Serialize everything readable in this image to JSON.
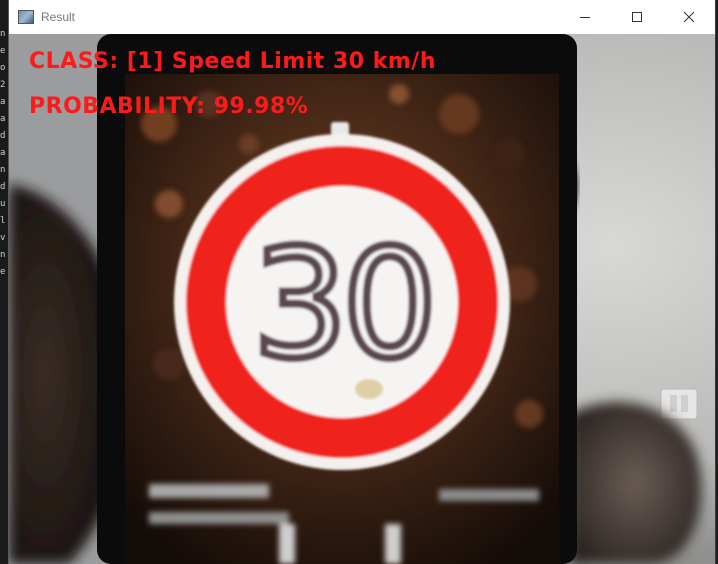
{
  "window": {
    "title": "Result",
    "icon": "opencv-window-icon",
    "controls": [
      "minimize-icon",
      "maximize-icon",
      "close-icon"
    ]
  },
  "overlay": {
    "class_text": "CLASS:  [1] Speed Limit 30 km/h",
    "probability_text": "PROBABILITY: 99.98%",
    "text_color": "#ff1a1a"
  },
  "sign": {
    "number": "30",
    "ring_color": "#f0201c"
  },
  "background_strip": {
    "chars": "n e o 2 a a d a n d u l v n e"
  }
}
